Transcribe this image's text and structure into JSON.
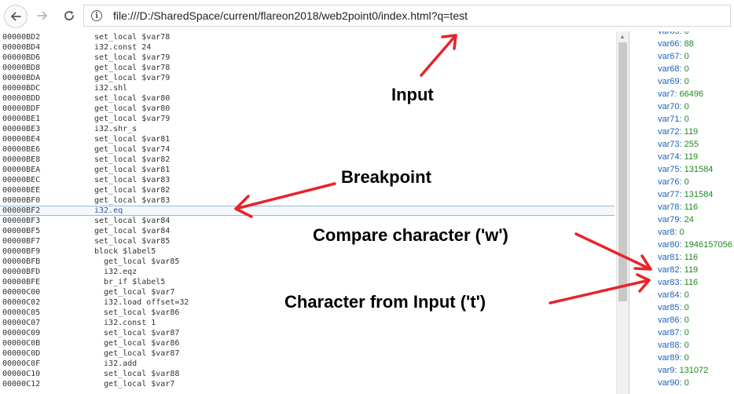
{
  "address_bar": {
    "url": "file:///D:/SharedSpace/current/flareon2018/web2point0/index.html?q=test"
  },
  "code_lines": [
    {
      "addr": "00000BD2",
      "instr": "set_local $var78"
    },
    {
      "addr": "00000BD4",
      "instr": "i32.const 24"
    },
    {
      "addr": "00000BD6",
      "instr": "set_local $var79"
    },
    {
      "addr": "00000BD8",
      "instr": "get_local $var78"
    },
    {
      "addr": "00000BDA",
      "instr": "get_local $var79"
    },
    {
      "addr": "00000BDC",
      "instr": "i32.shl"
    },
    {
      "addr": "00000BDD",
      "instr": "set_local $var80"
    },
    {
      "addr": "00000BDF",
      "instr": "get_local $var80"
    },
    {
      "addr": "00000BE1",
      "instr": "get_local $var79"
    },
    {
      "addr": "00000BE3",
      "instr": "i32.shr_s"
    },
    {
      "addr": "00000BE4",
      "instr": "set_local $var81"
    },
    {
      "addr": "00000BE6",
      "instr": "get_local $var74"
    },
    {
      "addr": "00000BE8",
      "instr": "set_local $var82"
    },
    {
      "addr": "00000BEA",
      "instr": "get_local $var81"
    },
    {
      "addr": "00000BEC",
      "instr": "set_local $var83"
    },
    {
      "addr": "00000BEE",
      "instr": "get_local $var82"
    },
    {
      "addr": "00000BF0",
      "instr": "get_local $var83"
    },
    {
      "addr": "00000BF2",
      "instr": "i32.eq",
      "breakpoint": true
    },
    {
      "addr": "00000BF3",
      "instr": "set_local $var84"
    },
    {
      "addr": "00000BF5",
      "instr": "get_local $var84"
    },
    {
      "addr": "00000BF7",
      "instr": "set_local $var85"
    },
    {
      "addr": "00000BF9",
      "instr": "block $label5"
    },
    {
      "addr": "00000BFB",
      "instr": "  get_local $var85"
    },
    {
      "addr": "00000BFD",
      "instr": "  i32.eqz"
    },
    {
      "addr": "00000BFE",
      "instr": "  br_if $label5"
    },
    {
      "addr": "00000C00",
      "instr": "  get_local $var7"
    },
    {
      "addr": "00000C02",
      "instr": "  i32.load offset=32"
    },
    {
      "addr": "00000C05",
      "instr": "  set_local $var86"
    },
    {
      "addr": "00000C07",
      "instr": "  i32.const 1"
    },
    {
      "addr": "00000C09",
      "instr": "  set_local $var87"
    },
    {
      "addr": "00000C0B",
      "instr": "  get_local $var86"
    },
    {
      "addr": "00000C0D",
      "instr": "  get_local $var87"
    },
    {
      "addr": "00000C0F",
      "instr": "  i32.add"
    },
    {
      "addr": "00000C10",
      "instr": "  set_local $var88"
    },
    {
      "addr": "00000C12",
      "instr": "  get_local $var7"
    }
  ],
  "variables": [
    {
      "name": "var65:",
      "value": "0"
    },
    {
      "name": "var66:",
      "value": "88"
    },
    {
      "name": "var67:",
      "value": "0"
    },
    {
      "name": "var68:",
      "value": "0"
    },
    {
      "name": "var69:",
      "value": "0"
    },
    {
      "name": "var7:",
      "value": "66496"
    },
    {
      "name": "var70:",
      "value": "0"
    },
    {
      "name": "var71:",
      "value": "0"
    },
    {
      "name": "var72:",
      "value": "119"
    },
    {
      "name": "var73:",
      "value": "255"
    },
    {
      "name": "var74:",
      "value": "119"
    },
    {
      "name": "var75:",
      "value": "131584"
    },
    {
      "name": "var76:",
      "value": "0"
    },
    {
      "name": "var77:",
      "value": "131584"
    },
    {
      "name": "var78:",
      "value": "116"
    },
    {
      "name": "var79:",
      "value": "24"
    },
    {
      "name": "var8:",
      "value": "0"
    },
    {
      "name": "var80:",
      "value": "1946157056"
    },
    {
      "name": "var81:",
      "value": "116"
    },
    {
      "name": "var82:",
      "value": "119"
    },
    {
      "name": "var83:",
      "value": "116"
    },
    {
      "name": "var84:",
      "value": "0"
    },
    {
      "name": "var85:",
      "value": "0"
    },
    {
      "name": "var86:",
      "value": "0"
    },
    {
      "name": "var87:",
      "value": "0"
    },
    {
      "name": "var88:",
      "value": "0"
    },
    {
      "name": "var89:",
      "value": "0"
    },
    {
      "name": "var9:",
      "value": "131072"
    },
    {
      "name": "var90:",
      "value": "0"
    }
  ],
  "annotations": {
    "input": "Input",
    "breakpoint": "Breakpoint",
    "compare": "Compare character ('w')",
    "from_input": "Character from Input ('t')"
  },
  "colors": {
    "annotation_arrow": "#e8232b",
    "var_name": "#1a63b8",
    "var_value": "#1f8a1f"
  },
  "icons": {
    "back": "arrow-left-icon",
    "forward": "arrow-right-icon",
    "reload": "reload-icon",
    "info": "info-icon"
  }
}
